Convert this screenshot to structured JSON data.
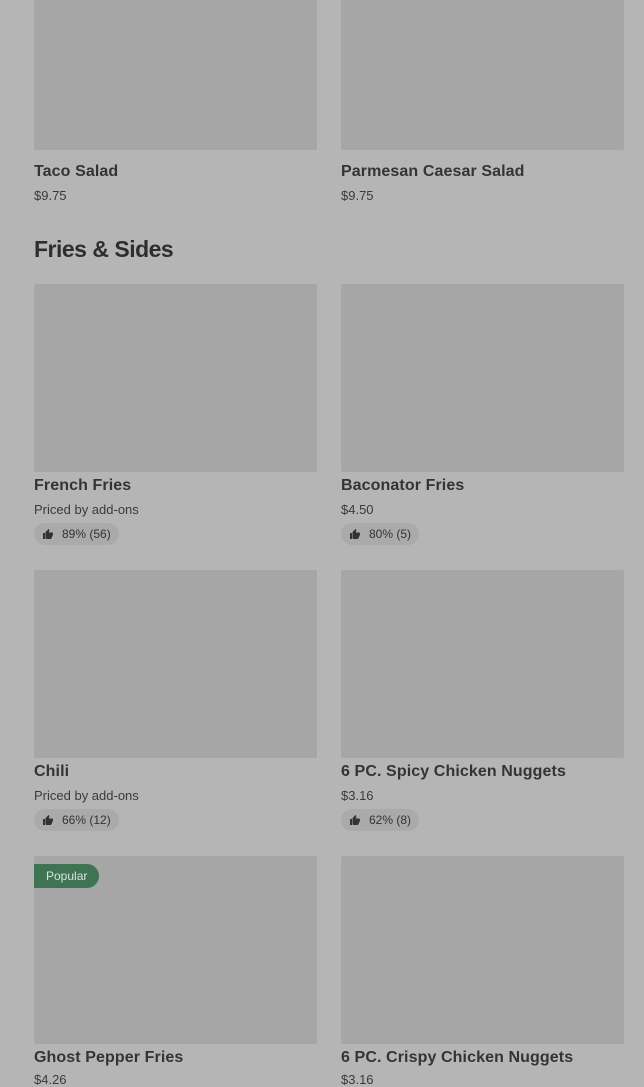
{
  "top_row": [
    {
      "title": "Taco Salad",
      "price": "$9.75"
    },
    {
      "title": "Parmesan Caesar Salad",
      "price": "$9.75"
    }
  ],
  "section": {
    "heading": "Fries & Sides"
  },
  "items": [
    {
      "title": "French Fries",
      "price": "Priced by add-ons",
      "rating": "89% (56)"
    },
    {
      "title": "Baconator Fries",
      "price": "$4.50",
      "rating": "80% (5)"
    },
    {
      "title": "Chili",
      "price": "Priced by add-ons",
      "rating": "66% (12)"
    },
    {
      "title": "6 PC. Spicy Chicken Nuggets",
      "price": "$3.16",
      "rating": "62% (8)"
    },
    {
      "title": "Ghost Pepper Fries",
      "price": "$4.26",
      "badge": "Popular"
    },
    {
      "title": "6 PC. Crispy Chicken Nuggets",
      "price": "$3.16"
    }
  ],
  "icons": {
    "rating": "thumbs-up-icon"
  },
  "colors": {
    "background": "#b5b5b5",
    "image_placeholder": "#a6a6a6",
    "badge": "#3f7452"
  }
}
